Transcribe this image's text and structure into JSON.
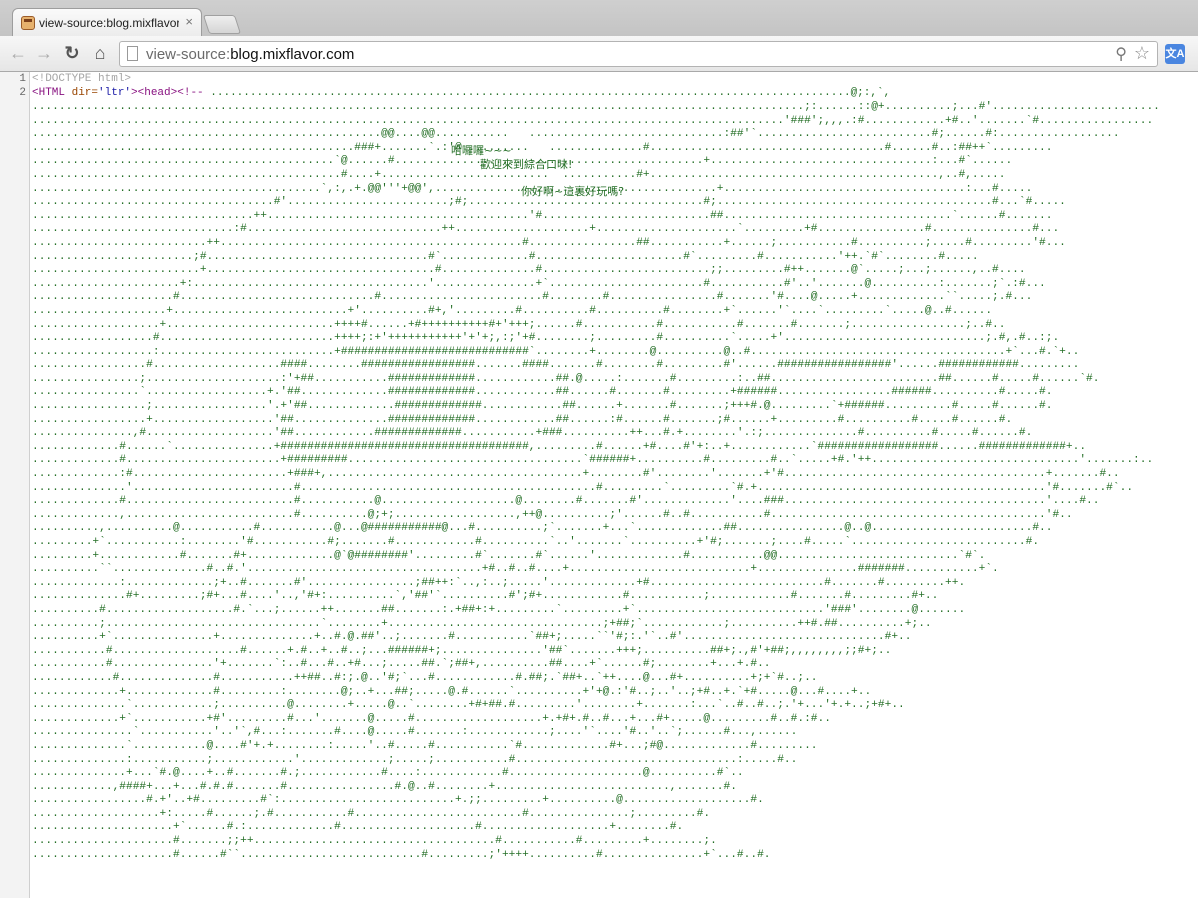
{
  "tab": {
    "title": "view-source:blog.mixflavor.com",
    "close": "×"
  },
  "toolbar": {
    "back": "←",
    "forward": "→",
    "reload": "↻",
    "home": "⌂"
  },
  "omnibox": {
    "scheme": "view-source:",
    "host": "blog.mixflavor.com"
  },
  "icons": {
    "zoom": "search-icon",
    "star": "star-icon",
    "translate": "translate-icon",
    "translate_glyph": "文A"
  },
  "source": {
    "line_numbers": [
      "1",
      "2"
    ],
    "line1": "<!DOCTYPE html>",
    "line2_tag_open": "<HTML ",
    "line2_attr": "dir=",
    "line2_val": "'ltr'",
    "line2_rest": "><head>",
    "line2_comment_start": "<!-- ",
    "line2_comment_tail": ".................................................................................................@;:,`,",
    "ascii_art": "...................................................................................................................;:......::@+..........;...#'.........................\n................................................................................................................'###';,,,.:#............+#..'.......`#.................\n....................................................@@....@@...........   .............................:##'`..........................#;......#:..................\n................................................###+.......`.:'@..........   ..............#...................................#......#..:##++`.........\n.............................................`@......#..............................................+.................................:...#`......\n..............................................#....+.........................  ...........#+...........................................,..#,.....\n...........................................`,:,.+.@@'''+@@',..........................................+....................................:...#.....\n....................................#'........................;#;...................................#;.........................................#...`#.....\n.................................++.......................................'#.........................##..................................`......#.......\n..............................:#.............................++....................+.....................`.........+#................#...............#...\n..........................++.............................................#................##...........+......;...........#..........;.....#.........'#...\n........................;#.................................#`.............#......................#`.........#...........'++.`#`........#.....\n.........................+..................................#..............#.........................;;.........#++.......@`.....;...;......,..#....\n......................+:...................................'...............+`.......................#...........#'..'.......@..........:.......;`.:#...\n.....................#.............................#........................#........#................#.......'#....@.....+.............``.....;.#...\n....................+..........................+'..........#+,'.........#..........#..........#........+`......'`....`.........`.....@..#......\n...................+.........................++++#......+#++++++++++#+'+++;......#...........#...........#.......#.......;.................;..#..\n..................#..........................++++;:+'+++++++++++'+'+;,:;'+#........;.........#..........`.....+'..............................;.#,.#..:;.\n..................:..........................+############################`........+........@..........@..#......................................+`...#.`+..\n.................#...................####........#################.......####.......#........#.........#'......#################'......############.........\n................;....................:'+##...........#############............##.@.....:.......#.........:..##.........................##......#.....#......`#.\n................`..................+.'##.............#############............##......#.......#.........+######.................######..........#.....#.\n.................;.................'.+'##.............#############............##......+.......#.......;+++#.@.........`+######..........#.....#......#.\n.................+..................'##..............#############............##......:#......#.......;#......+.........#..........#.....#......#.\n...............,#...................'##............#############...........+###..........++...#.+........'.:;..............#..........#.....#......#.\n.............#......`...............+#####################################,.........#......+#....#'+:..+............`##################......#############+..\n.............#.......................+#########...................................`######+..........#.........#..`.....+#.'++...............................'.......:..\n.............:#.......................+###+,......................................+........#'........'.......+'#.......................................+.......#..\n..............'........................#............................................#.........`.........`#.+...........................................'#.......#`..\n.............#.........................#...........@....................@........#.......#'.............'....###.......................................'....#..\n.............,.........................#..........@;+;..................,++@..........;'......#..#...........#.........................................'#..\n..........,..........@...........#...........@...@###########@...#..........;`.......+...`.............##................@..@........................#..\n.........+`...........:........'#...........#;.......#............#..........`..'.......`..........+'#;.......;....#.....`..........................#.\n.........+............#.......#+.............@`@########'.........#`.......#`......'.............#...........@@...........................`#`.\n..........``..............#..#.'...................................+#..#..#....+...........................+...............#######...........+`.\n.............:.............;+..#.......#'................;##++:`..,:..;.....'.............+#..........................#.......#.........++.\n..............#+.........;#+...#....'..,'#+:..........`,'##'`..........#';#+............#...........;............#.......#.........#+..\n..........#...................#.`...;......++.......##.......:.+##+:+.........`.........+`............................'###'........@.......\n..........;................................`........+................................;+##;`............;..........++#.##..........+;..\n..........+`...............+..............+..#.@.##'..;.......#...........`##+;.....``'#;:.'`..#'..............................#+..\n...........#...................#......+.#..+..#..;...######+;...............'##`.......+++;..........##+;.,#'+##;,,,,,,,,;;#+;..\n...........#...............'+.......`:..#...#..+#...;.....##.`;##+,..........##....+`......#;........+...+.#..\n............#..............#...........++##..#:;.@..'#;`...#............#.##;.`##+..`++....@...#+..........+;+`#..;..\n.............+.............#.........:........@;..+...##;.....@.#......`..........+'+@.:'#..;..'..;+#..+.`+#.....@...#....+..\n..............`............;..........@........+.....@..`........+#+##.#.........'........+.......:...`..#..#..;.'+...'+.+..;+#+..\n.............+`...........+#'.........#...'.......@.....#...................+.+#+.#..#...+...#+.....@.........#..#.:#..\n...............`...........'..'`,#...:.......#....@.....#.......:............;....'`....'#..'..`;......#...,......\n..............`...........@....#'+.+........:.....'..#.....#...........`#.............#+...;#@.............#.........\n..............:...........;............'.............;.....;...........#.................................:.....#..\n..............+...`#.@....+..#.......#.;............#....:............#....................@..........#`..\n............,####+...+...#.#.#.......#................#.@..#........+..........................,.......#.\n.................#.+'..+#.........#`:..........................+.;;.........+..........@...................#.\n...................+:.....#......;.#...........#.........................#...............;.........#.\n.....................+`......#.:.............#....................#...................+........#.\n.....................#.......;;++....................................#...........#.........+........;.\n.....................#......#``...........................#.........;'++++..........#...............+`...#..#.",
    "overlay1": "哈囉囉~~~",
    "overlay2": "歡迎來到綜合口味!",
    "overlay3": "你好啊~這裏好玩嗎?"
  }
}
